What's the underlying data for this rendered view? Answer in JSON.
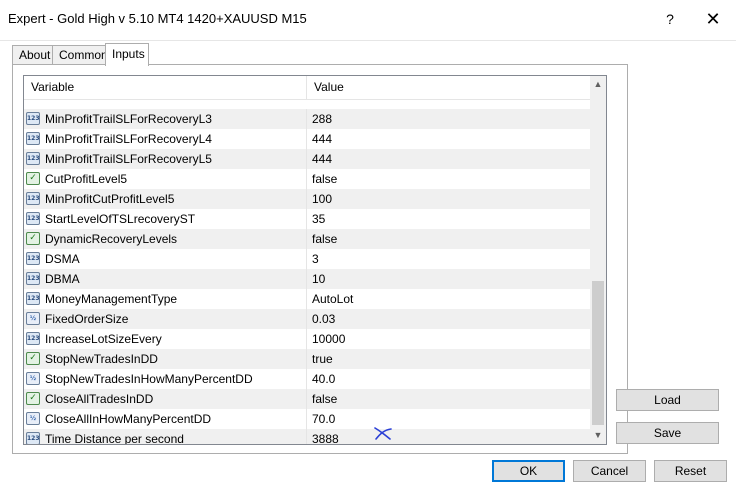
{
  "window": {
    "title": "Expert - Gold High v 5.10 MT4 1420+XAUUSD M15",
    "help_glyph": "?",
    "close_glyph": "✕"
  },
  "tabs": [
    {
      "label": "About",
      "active": false
    },
    {
      "label": "Common",
      "active": false
    },
    {
      "label": "Inputs",
      "active": true
    }
  ],
  "grid": {
    "columns": {
      "variable": "Variable",
      "value": "Value"
    },
    "rows": [
      {
        "type": "int",
        "icon": "123",
        "name": "MinProfitTrailSLForRecoveryL3",
        "value": "288"
      },
      {
        "type": "int",
        "icon": "123",
        "name": "MinProfitTrailSLForRecoveryL4",
        "value": "444"
      },
      {
        "type": "int",
        "icon": "123",
        "name": "MinProfitTrailSLForRecoveryL5",
        "value": "444"
      },
      {
        "type": "bool",
        "icon": "✓",
        "name": "CutProfitLevel5",
        "value": "false"
      },
      {
        "type": "int",
        "icon": "123",
        "name": "MinProfitCutProfitLevel5",
        "value": "100"
      },
      {
        "type": "int",
        "icon": "123",
        "name": "StartLevelOfTSLrecoveryST",
        "value": "35"
      },
      {
        "type": "bool",
        "icon": "✓",
        "name": "DynamicRecoveryLevels",
        "value": "false"
      },
      {
        "type": "int",
        "icon": "123",
        "name": "DSMA",
        "value": "3"
      },
      {
        "type": "int",
        "icon": "123",
        "name": "DBMA",
        "value": "10"
      },
      {
        "type": "int",
        "icon": "123",
        "name": "MoneyManagementType",
        "value": "AutoLot"
      },
      {
        "type": "dbl",
        "icon": "½",
        "name": "FixedOrderSize",
        "value": "0.03"
      },
      {
        "type": "int",
        "icon": "123",
        "name": "IncreaseLotSizeEvery",
        "value": "10000"
      },
      {
        "type": "bool",
        "icon": "✓",
        "name": "StopNewTradesInDD",
        "value": "true"
      },
      {
        "type": "dbl",
        "icon": "½",
        "name": "StopNewTradesInHowManyPercentDD",
        "value": "40.0"
      },
      {
        "type": "bool",
        "icon": "✓",
        "name": "CloseAllTradesInDD",
        "value": "false"
      },
      {
        "type": "dbl",
        "icon": "½",
        "name": "CloseAllInHowManyPercentDD",
        "value": "70.0"
      },
      {
        "type": "int",
        "icon": "123",
        "name": "Time Distance per second",
        "value": "3888"
      }
    ],
    "scroll_up_glyph": "▲",
    "scroll_down_glyph": "▼"
  },
  "buttons": {
    "load": "Load",
    "save": "Save",
    "ok": "OK",
    "cancel": "Cancel",
    "reset": "Reset"
  },
  "colors": {
    "annotation_mark": "#2a3fd6",
    "default_button_border": "#0078d7"
  }
}
